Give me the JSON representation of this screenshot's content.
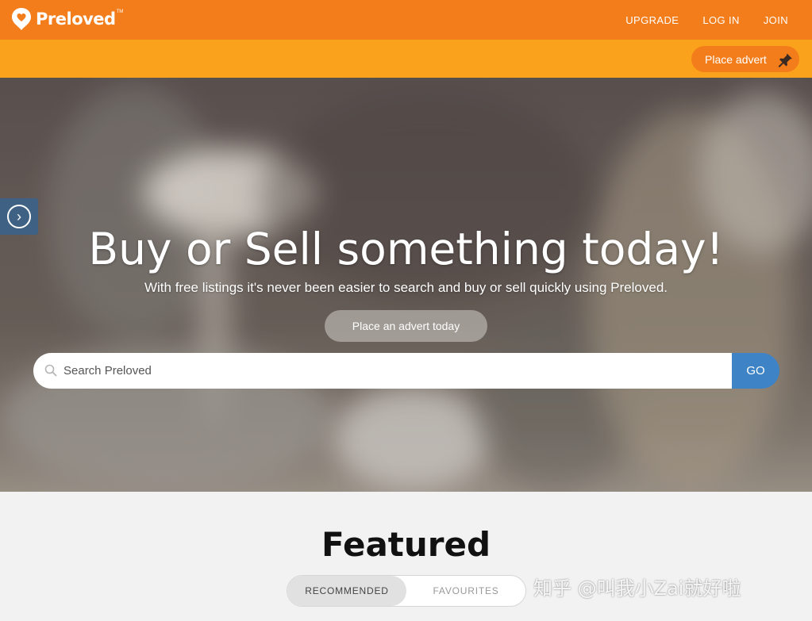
{
  "brand": {
    "name": "Preloved",
    "tm": "TM",
    "color": "#f47d1b",
    "subbar_color": "#fba21c"
  },
  "topnav": [
    {
      "label": "UPGRADE"
    },
    {
      "label": "LOG IN"
    },
    {
      "label": "JOIN"
    }
  ],
  "subbar": {
    "place_advert_label": "Place advert",
    "icon": "pin-icon"
  },
  "hero": {
    "title": "Buy or Sell something today!",
    "subtitle": "With free listings it's never been easier to search and buy or sell quickly using Preloved.",
    "cta_label": "Place an advert today",
    "side_toggle_icon": "chevron-right-icon"
  },
  "search": {
    "placeholder": "Search Preloved",
    "value": "",
    "button_label": "GO",
    "button_color": "#3d83c5",
    "icon": "search-icon"
  },
  "featured": {
    "title": "Featured",
    "tabs": [
      {
        "label": "RECOMMENDED",
        "active": true
      },
      {
        "label": "FAVOURITES",
        "active": false
      }
    ]
  },
  "watermark": "知乎 @叫我小Zai就好啦"
}
